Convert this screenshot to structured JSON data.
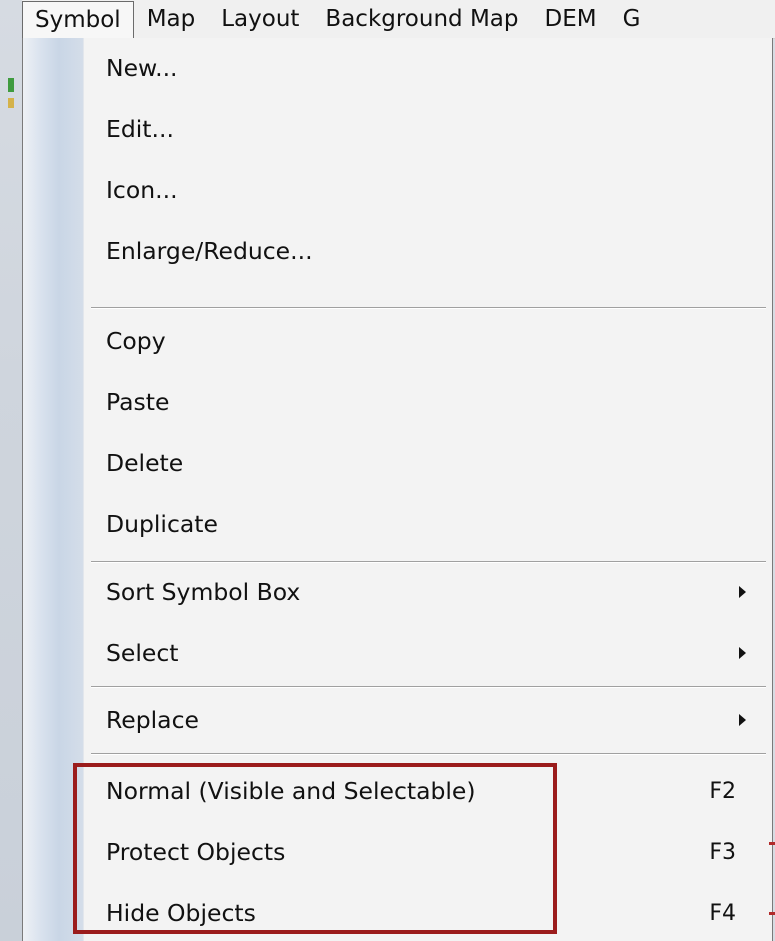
{
  "menubar": {
    "items": [
      {
        "label": "Symbol"
      },
      {
        "label": "Map"
      },
      {
        "label": "Layout"
      },
      {
        "label": "Background Map"
      },
      {
        "label": "DEM"
      },
      {
        "label": "G"
      }
    ]
  },
  "menu": {
    "groups": [
      [
        {
          "label": "New..."
        },
        {
          "label": "Edit..."
        },
        {
          "label": "Icon..."
        },
        {
          "label": "Enlarge/Reduce..."
        }
      ],
      [
        {
          "label": "Copy"
        },
        {
          "label": "Paste"
        },
        {
          "label": "Delete"
        },
        {
          "label": "Duplicate"
        }
      ],
      [
        {
          "label": "Sort Symbol Box",
          "submenu": true
        },
        {
          "label": "Select",
          "submenu": true
        }
      ],
      [
        {
          "label": "Replace",
          "submenu": true
        }
      ],
      [
        {
          "label": "Normal (Visible and Selectable)",
          "shortcut": "F2"
        },
        {
          "label": "Protect Objects",
          "shortcut": "F3"
        },
        {
          "label": "Hide Objects",
          "shortcut": "F4"
        }
      ]
    ]
  },
  "colors": {
    "highlight_border": "#9b1c1c",
    "menu_background": "#f3f3f3"
  }
}
